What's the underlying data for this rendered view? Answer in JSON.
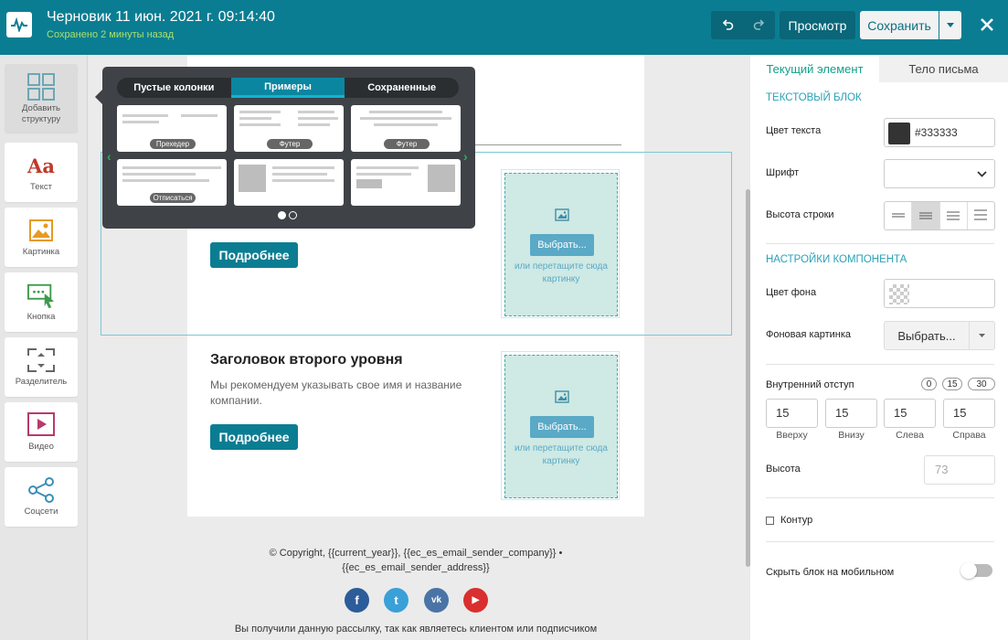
{
  "header": {
    "title": "Черновик 11 июн. 2021 г. 09:14:40",
    "saved_status": "Сохранено 2 минуты назад",
    "preview_label": "Просмотр",
    "save_label": "Сохранить"
  },
  "toolbar": {
    "items": [
      {
        "label": "Добавить структуру"
      },
      {
        "label": "Текст"
      },
      {
        "label": "Картинка"
      },
      {
        "label": "Кнопка"
      },
      {
        "label": "Разделитель"
      },
      {
        "label": "Видео"
      },
      {
        "label": "Соцсети"
      }
    ],
    "text_icon_glyph": "Aa"
  },
  "popover": {
    "tabs": [
      {
        "label": "Пустые колонки"
      },
      {
        "label": "Примеры"
      },
      {
        "label": "Сохраненные"
      }
    ],
    "active_tab": "Примеры",
    "templates": [
      {
        "tag": "Прехедер"
      },
      {
        "tag": "Футер"
      },
      {
        "tag": "Футер"
      },
      {
        "tag": "Отписаться"
      },
      {
        "tag": ""
      },
      {
        "tag": ""
      }
    ],
    "pages": 2,
    "current_page": 1
  },
  "email": {
    "button_label": "Подробнее",
    "heading2": "Заголовок второго уровня",
    "paragraph": "Мы рекомендуем указывать свое имя и название компании.",
    "image_slot": {
      "choose_label": "Выбрать...",
      "drag_hint": "или перетащите сюда картинку"
    },
    "footer_copyright_line1": "© Copyright, {{current_year}}, {{ec_es_email_sender_company}} •",
    "footer_copyright_line2": "{{ec_es_email_sender_address}}",
    "social_icons": [
      {
        "icon": "facebook-icon",
        "glyph": "f",
        "color": "#2d5c9a"
      },
      {
        "icon": "twitter-icon",
        "glyph": "t",
        "color": "#3aa0d8"
      },
      {
        "icon": "vk-icon",
        "glyph": "vk",
        "color": "#4a74a5"
      },
      {
        "icon": "youtube-icon",
        "glyph": "▶",
        "color": "#d92f2f"
      }
    ],
    "footer_note": "Вы получили данную рассылку, так как являетесь клиентом или подписчиком"
  },
  "panel": {
    "tabs": [
      {
        "label": "Текущий элемент"
      },
      {
        "label": "Тело письма"
      }
    ],
    "section_text_block": "ТЕКСТОВЫЙ БЛОК",
    "text_color_label": "Цвет текста",
    "text_color_value": "#333333",
    "font_label": "Шрифт",
    "line_height_label": "Высота строки",
    "section_component": "НАСТРОЙКИ КОМПОНЕНТА",
    "bg_color_label": "Цвет фона",
    "bg_image_label": "Фоновая картинка",
    "bg_image_button": "Выбрать...",
    "padding_label": "Внутренний отступ",
    "padding_presets": [
      "0",
      "15",
      "30"
    ],
    "padding": [
      {
        "value": "15",
        "label": "Вверху"
      },
      {
        "value": "15",
        "label": "Внизу"
      },
      {
        "value": "15",
        "label": "Слева"
      },
      {
        "value": "15",
        "label": "Справа"
      }
    ],
    "height_label": "Высота",
    "height_placeholder": "73",
    "outline_label": "Контур",
    "hide_mobile_label": "Скрыть блок на мобильном"
  },
  "colors": {
    "header_bg": "#0b7d92",
    "accent_green": "#12a089",
    "section_title": "#2aa2b8",
    "button_bg": "#0b7d92"
  }
}
